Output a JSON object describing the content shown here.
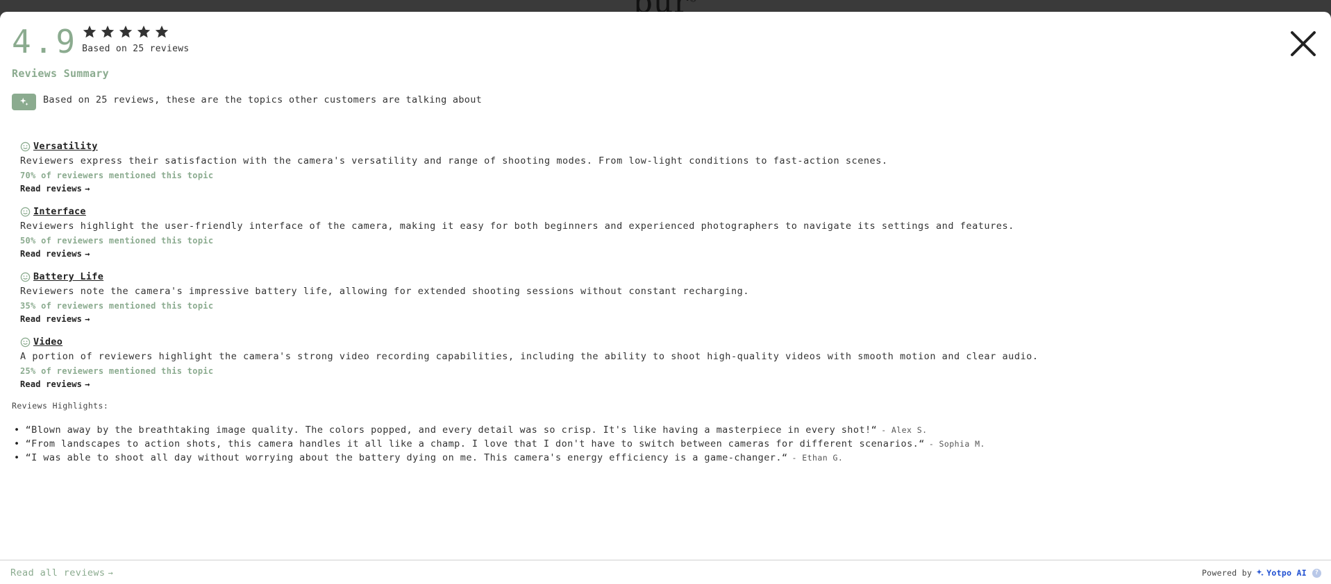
{
  "backdrop": {
    "logo_text": "pür",
    "logo_mark": "®"
  },
  "rating": {
    "average": "4.9",
    "stars": 5,
    "based_on": "Based on 25 reviews"
  },
  "summary": {
    "title": "Reviews Summary",
    "ai_intro": "Based on 25 reviews, these are the topics other customers are talking about"
  },
  "topics": [
    {
      "name": "Versatility",
      "description": "Reviewers express their satisfaction with the camera's versatility and range of shooting modes. From low-light conditions to fast-action scenes.",
      "mention": "70% of reviewers mentioned this topic",
      "link": "Read reviews"
    },
    {
      "name": "Interface",
      "description": "Reviewers highlight the user-friendly interface of the camera, making it easy for both beginners and experienced photographers to navigate its settings and features.",
      "mention": "50% of reviewers mentioned this topic",
      "link": "Read reviews"
    },
    {
      "name": "Battery Life",
      "description": "Reviewers note the camera's impressive battery life, allowing for extended shooting sessions without constant recharging.",
      "mention": "35% of reviewers mentioned this topic",
      "link": "Read reviews"
    },
    {
      "name": "Video",
      "description": "A portion of reviewers highlight the camera's strong video recording capabilities, including the ability to shoot high-quality videos with smooth motion and clear audio.",
      "mention": "25% of reviewers mentioned this topic",
      "link": "Read reviews"
    }
  ],
  "highlights": {
    "label": "Reviews Highlights:",
    "items": [
      {
        "quote": "“Blown away by the breathtaking image quality. The colors popped, and every detail was so crisp. It's like having a masterpiece in every shot!“",
        "author": "- Alex S."
      },
      {
        "quote": "“From landscapes to action shots, this camera handles it all like a champ. I love that I don't have to switch between cameras for different scenarios.“",
        "author": "- Sophia M."
      },
      {
        "quote": "“I was able to shoot all day without worrying about the battery dying on me. This camera's energy efficiency is a game-changer.“",
        "author": "- Ethan G."
      }
    ]
  },
  "footer": {
    "read_all": "Read all reviews",
    "powered_by": "Powered by",
    "brand": "Yotpo AI",
    "help": "?"
  },
  "colors": {
    "accent": "#8bab8f",
    "brand_blue": "#1f4fd1",
    "text": "#2b2b2b"
  },
  "icons": {
    "close": "close-icon",
    "star": "star-icon",
    "ai": "sparkle-icon",
    "topic": "smiley-icon",
    "arrow": "arrow-right-icon"
  }
}
